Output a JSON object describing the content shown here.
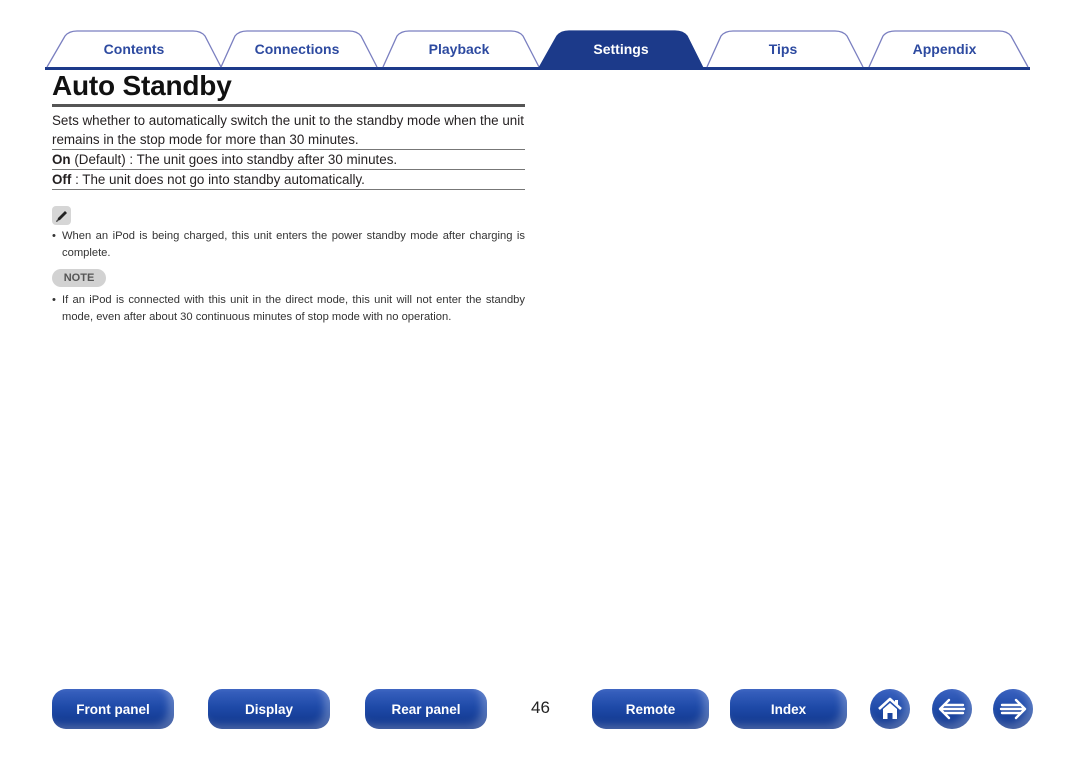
{
  "tabs": [
    {
      "label": "Contents",
      "active": false
    },
    {
      "label": "Connections",
      "active": false
    },
    {
      "label": "Playback",
      "active": false
    },
    {
      "label": "Settings",
      "active": true
    },
    {
      "label": "Tips",
      "active": false
    },
    {
      "label": "Appendix",
      "active": false
    }
  ],
  "page": {
    "title": "Auto Standby",
    "description": "Sets whether to automatically switch the unit to the standby mode when the unit remains in the stop mode for more than 30 minutes.",
    "options": [
      {
        "name": "On",
        "detail": " (Default) : The unit goes into standby after 30 minutes."
      },
      {
        "name": "Off",
        "detail": " : The unit does not go into standby automatically."
      }
    ],
    "memo_icon": "pencil-icon",
    "memo_items": [
      "When an iPod is being charged, this unit enters the power standby mode after charging is complete."
    ],
    "note_label": "NOTE",
    "note_items": [
      "If an iPod is connected with this unit in the direct mode, this unit will not enter the standby mode, even after about 30 continuous minutes of stop mode with no operation."
    ],
    "bullet": "•"
  },
  "footer": {
    "buttons": [
      "Front panel",
      "Display",
      "Rear panel",
      "Remote",
      "Index"
    ],
    "page_number": "46",
    "icons": [
      "home-icon",
      "back-arrow-icon",
      "forward-arrow-icon"
    ]
  },
  "colors": {
    "accent": "#1c3a8a",
    "tab_text": "#2d4aa0"
  }
}
